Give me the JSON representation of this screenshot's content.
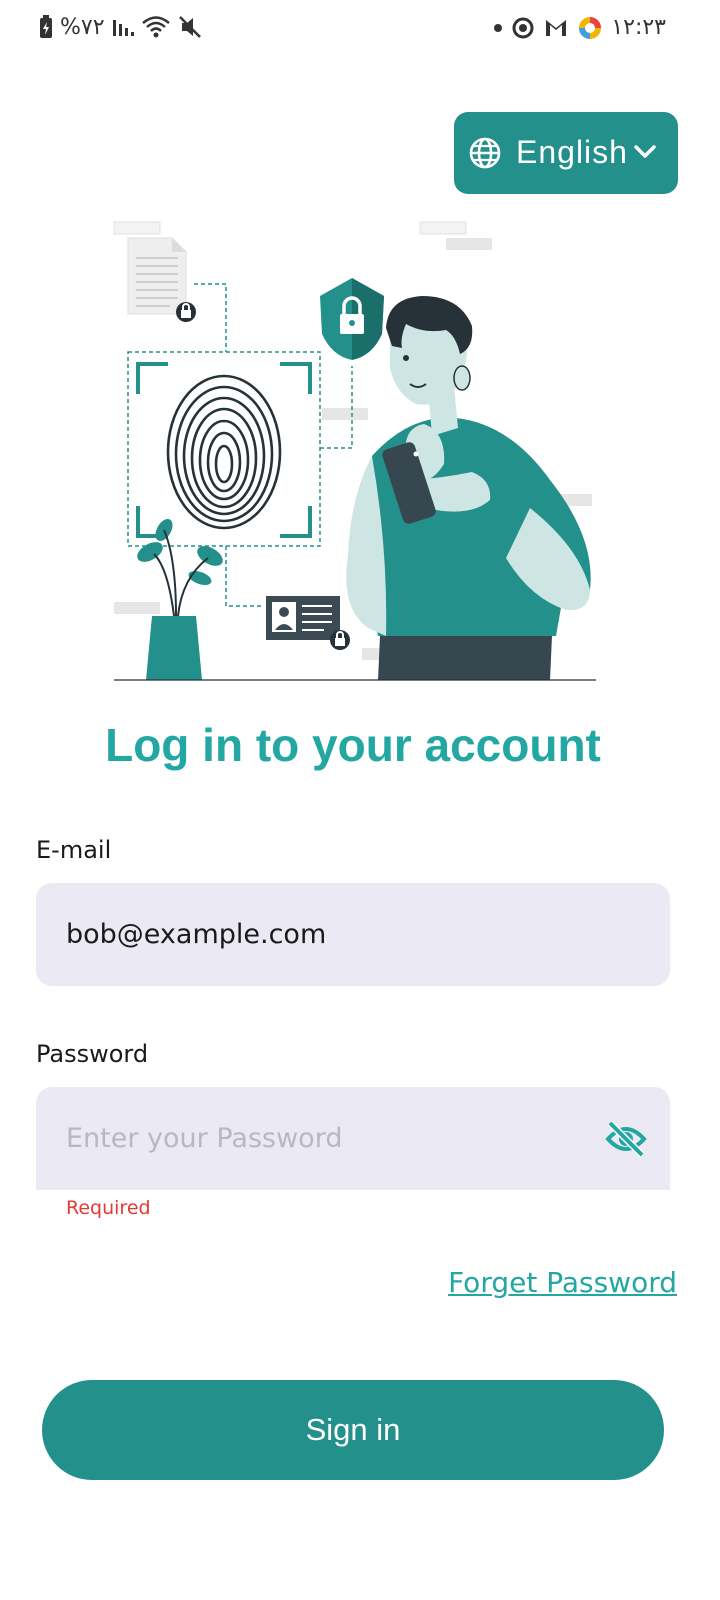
{
  "status_bar": {
    "battery_text": "%۷۲",
    "time": "۱۲:۲۳"
  },
  "language": {
    "label": "English"
  },
  "login": {
    "title": "Log in to your account",
    "email_label": "E-mail",
    "email_value": "bob@example.com",
    "password_label": "Password",
    "password_placeholder": "Enter your Password",
    "password_error": "Required",
    "forgot_password": "Forget Password",
    "sign_in": "Sign in"
  },
  "colors": {
    "primary": "#23908b",
    "title": "#23a7a2",
    "input_bg": "#ebe9f4",
    "error": "#e53935"
  }
}
